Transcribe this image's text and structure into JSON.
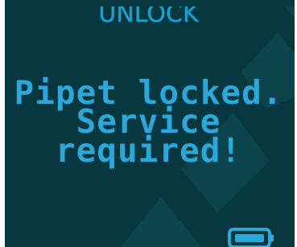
{
  "screen": {
    "title": "UNLOCK",
    "message_lines": [
      "Pipet locked.",
      "Service",
      "required!"
    ]
  },
  "status": {
    "battery_icon": "battery-icon"
  },
  "colors": {
    "background": "#073840",
    "text": "#2ba7da",
    "watermark": "#0d4650"
  }
}
